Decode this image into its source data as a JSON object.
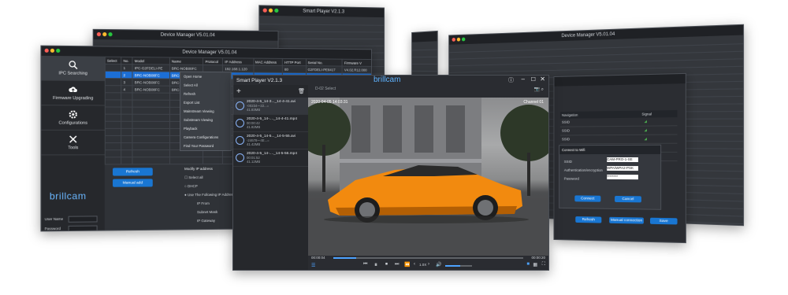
{
  "back_windows": {
    "top_center_title": "Smart Player V2.1.3",
    "mid_title": "Device Manager V5.01.04",
    "right_title": "Device Manager V5.01.04"
  },
  "device_manager": {
    "title": "Device Manager V5.01.04",
    "sidebar": [
      {
        "label": "IPC Searching",
        "icon": "search-icon"
      },
      {
        "label": "Firmware Upgrading",
        "icon": "cloud-upload-icon"
      },
      {
        "label": "Configurations",
        "icon": "gear-icon"
      },
      {
        "label": "Tools",
        "icon": "tools-icon"
      }
    ],
    "brand": "brillcam",
    "login": {
      "user_label": "User Name",
      "password_label": "Password"
    },
    "table": {
      "headers": [
        "Select",
        "No.",
        "Model",
        "Name",
        "Protocol",
        "IP Address",
        "MAC Address",
        "HTTP Port",
        "Serial No.",
        "Firmware V"
      ],
      "rows": [
        [
          "",
          "1",
          "IPC-G2FDELI-PE",
          "BRC-NOB08FC",
          "",
          "192.168.1.120",
          "",
          "80",
          "G2FDELI-PE8417",
          "V4.02.R12.000"
        ],
        [
          "",
          "2",
          "BRC-NOB08FC",
          "BRC-NOB08FC",
          "Private",
          "",
          "",
          "",
          "",
          ""
        ],
        [
          "",
          "3",
          "BRC-NOB08FC",
          "BRC-NOB08FC",
          "",
          "",
          "",
          "",
          "",
          ""
        ],
        [
          "",
          "4",
          "BRC-NOB08FC",
          "BRC-NOB08FC",
          "",
          "",
          "",
          "",
          "",
          ""
        ]
      ]
    },
    "context_menu": [
      "Open Home",
      "Select All",
      "Refresh",
      "Export List",
      "Mainstream Viewing",
      "Substream Viewing",
      "Playback",
      "Camera Configurations",
      "Find Your Password"
    ],
    "buttons": {
      "refresh": "Refresh",
      "manual_add": "Manual add"
    },
    "modify_ip": {
      "title": "Modify IP address",
      "select_all": "Select all",
      "dhcp": "DHCP",
      "use_following": "Use The Following IP Address",
      "ip_from": "IP From",
      "subnet": "Subnet Mask",
      "gateway": "IP Gateway"
    }
  },
  "player": {
    "title": "Smart Player V2.1.3",
    "brand": "brillcam",
    "tab_label": "D-02 Select",
    "files": [
      {
        "name": "2020-4-5_14-3..._14-4-41.avi",
        "duration": "-00234~-22...=",
        "size": "41.83MB"
      },
      {
        "name": "2020-4-5_14-...._14-4-41.mp4",
        "duration": "00:00:42",
        "size": "41.82MB"
      },
      {
        "name": "2020-4-5_14-5..._14-5-55.avi",
        "duration": "-24678~-4E...=",
        "size": "41.42MB"
      },
      {
        "name": "2020-4-5_14-...._14-5-56.mp4",
        "duration": "00:01:52",
        "size": "41.12MB"
      }
    ],
    "osd_left": "2020-04-05 14:03:31",
    "osd_right": "Channel 01",
    "time_current": "00:00:04",
    "time_total": "00:00:20",
    "speed": "1.0X",
    "progress": 0.12,
    "volume": 0.55
  },
  "wifi_dialog": {
    "title": "Connect to Wifi",
    "ssid_label": "SSID",
    "ssid_value": "CAM-PRO-1-SE",
    "auth_label": "Authentication/encryption",
    "auth_value": "WPA/WPA2-PSK",
    "password_label": "Password",
    "password_value": "********",
    "connect": "Connect",
    "cancel": "Cancel",
    "networks_header": [
      "Navigation",
      "Signal"
    ],
    "networks": [
      "SSID",
      "SSID",
      "SSID",
      "SSID",
      "SSID"
    ],
    "footer_buttons": [
      "Refresh",
      "Manual connection",
      "Save"
    ]
  },
  "colors": {
    "accent": "#1976d2",
    "brand": "#5fb3ff",
    "window": "#2f3237"
  }
}
